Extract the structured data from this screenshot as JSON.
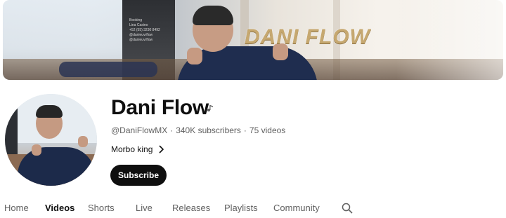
{
  "banner": {
    "brand_text": "DANI FLOW",
    "info_lines": [
      "Booking",
      "Lina Casino",
      "+52 (55) 3230 8492",
      "@danieuvrflow",
      "@danieuvrflow"
    ]
  },
  "channel": {
    "name": "Dani Flow",
    "handle": "@DaniFlowMX",
    "separator": "·",
    "subscribers": "340K subscribers",
    "videos": "75 videos",
    "description": "Morbo king",
    "subscribe_label": "Subscribe"
  },
  "tabs": [
    {
      "label": "Home",
      "active": false
    },
    {
      "label": "Videos",
      "active": true
    },
    {
      "label": "Shorts",
      "active": false
    },
    {
      "label": "Live",
      "active": false
    },
    {
      "label": "Releases",
      "active": false
    },
    {
      "label": "Playlists",
      "active": false
    },
    {
      "label": "Community",
      "active": false
    }
  ],
  "icons": {
    "verified": "verified-note-icon",
    "chevron": "chevron-right-icon",
    "search": "search-icon"
  },
  "colors": {
    "subscribe_bg": "#0f0f0f",
    "text_primary": "#0f0f0f",
    "text_secondary": "#606060"
  }
}
